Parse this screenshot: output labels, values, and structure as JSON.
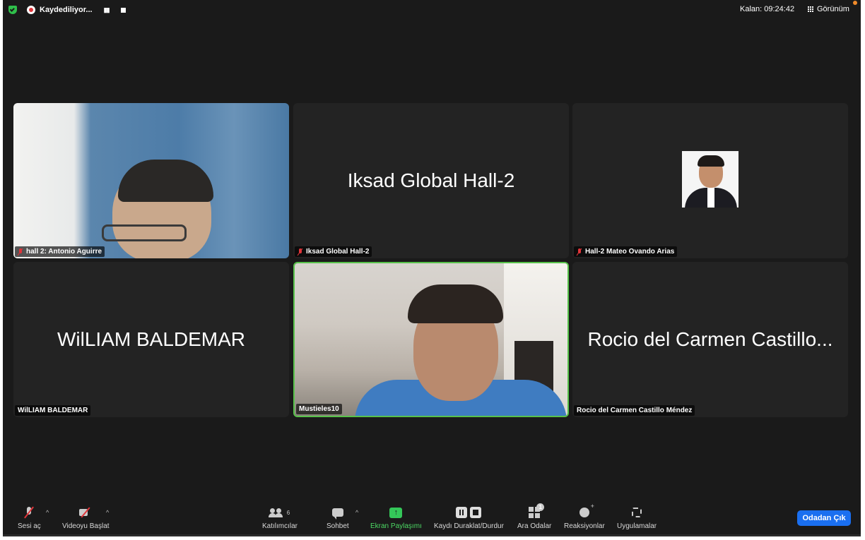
{
  "topbar": {
    "recording_label": "Kaydediliyor...",
    "pause_glyph": "▮▮",
    "timer": "Kalan: 09:24:42",
    "view_label": "Görünüm"
  },
  "tiles": [
    {
      "name": "hall 2: Antonio Aguirre",
      "big": "",
      "muted": true,
      "video": true
    },
    {
      "name": "Iksad Global Hall-2",
      "big": "Iksad Global Hall-2",
      "muted": true,
      "video": false
    },
    {
      "name": "Hall-2 Mateo Ovando Arias",
      "big": "",
      "muted": true,
      "video": false,
      "avatar": true
    },
    {
      "name": "WilLIAM BALDEMAR",
      "big": "WilLIAM BALDEMAR",
      "muted": false,
      "video": false
    },
    {
      "name": "Mustieles10",
      "big": "",
      "muted": false,
      "video": true,
      "active": true
    },
    {
      "name": "Rocio del Carmen Castillo Méndez",
      "big": "Rocio del Carmen Castillo...",
      "muted": false,
      "video": false
    }
  ],
  "toolbar": {
    "audio": "Sesi aç",
    "video": "Videoyu Başlat",
    "participants": "Katılımcılar",
    "participants_count": "6",
    "chat": "Sohbet",
    "share": "Ekran Paylaşımı",
    "record": "Kaydı Duraklat/Durdur",
    "rooms": "Ara Odalar",
    "rooms_badge": "1",
    "reactions": "Reaksiyonlar",
    "apps": "Uygulamalar",
    "leave": "Odadan Çık",
    "caret": "^"
  },
  "colors": {
    "background": "#1a1a1a",
    "tile": "#232323",
    "active_border": "#57c24a",
    "leave_button": "#1a6ff0",
    "share_green": "#34c759",
    "muted_red": "#e0353a"
  }
}
